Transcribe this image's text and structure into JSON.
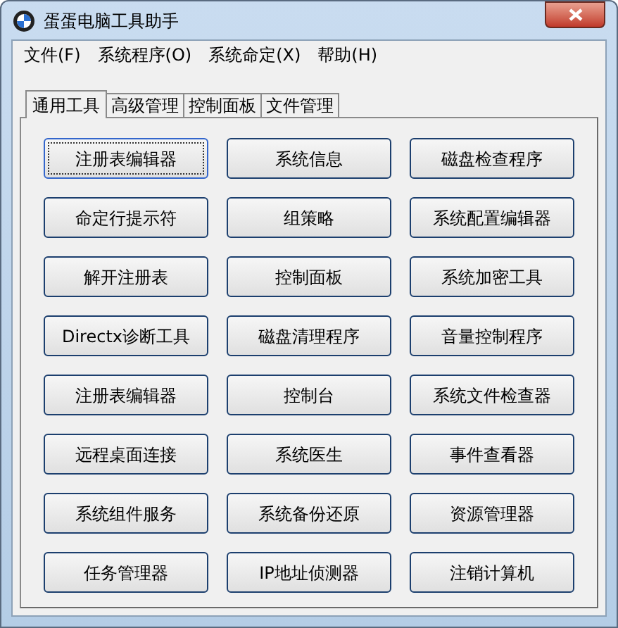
{
  "window": {
    "title": "蛋蛋电脑工具助手"
  },
  "menu": [
    {
      "label": "文件(F)"
    },
    {
      "label": "系统程序(O)"
    },
    {
      "label": "系统命定(X)"
    },
    {
      "label": "帮助(H)"
    }
  ],
  "tabs": [
    {
      "label": "通用工具",
      "selected": true
    },
    {
      "label": "高级管理",
      "selected": false
    },
    {
      "label": "控制面板",
      "selected": false
    },
    {
      "label": "文件管理",
      "selected": false
    }
  ],
  "buttons": [
    {
      "label": "注册表编辑器",
      "focused": true
    },
    {
      "label": "系统信息",
      "focused": false
    },
    {
      "label": "磁盘检查程序",
      "focused": false
    },
    {
      "label": "命定行提示符",
      "focused": false
    },
    {
      "label": "组策略",
      "focused": false
    },
    {
      "label": "系统配置编辑器",
      "focused": false
    },
    {
      "label": "解开注册表",
      "focused": false
    },
    {
      "label": "控制面板",
      "focused": false
    },
    {
      "label": "系统加密工具",
      "focused": false
    },
    {
      "label": "Directx诊断工具",
      "focused": false
    },
    {
      "label": "磁盘清理程序",
      "focused": false
    },
    {
      "label": "音量控制程序",
      "focused": false
    },
    {
      "label": "注册表编辑器",
      "focused": false
    },
    {
      "label": "控制台",
      "focused": false
    },
    {
      "label": "系统文件检查器",
      "focused": false
    },
    {
      "label": "远程桌面连接",
      "focused": false
    },
    {
      "label": "系统医生",
      "focused": false
    },
    {
      "label": "事件查看器",
      "focused": false
    },
    {
      "label": "系统组件服务",
      "focused": false
    },
    {
      "label": "系统备份还原",
      "focused": false
    },
    {
      "label": "资源管理器",
      "focused": false
    },
    {
      "label": "任务管理器",
      "focused": false
    },
    {
      "label": "IP地址侦测器",
      "focused": false
    },
    {
      "label": "注销计算机",
      "focused": false
    }
  ]
}
